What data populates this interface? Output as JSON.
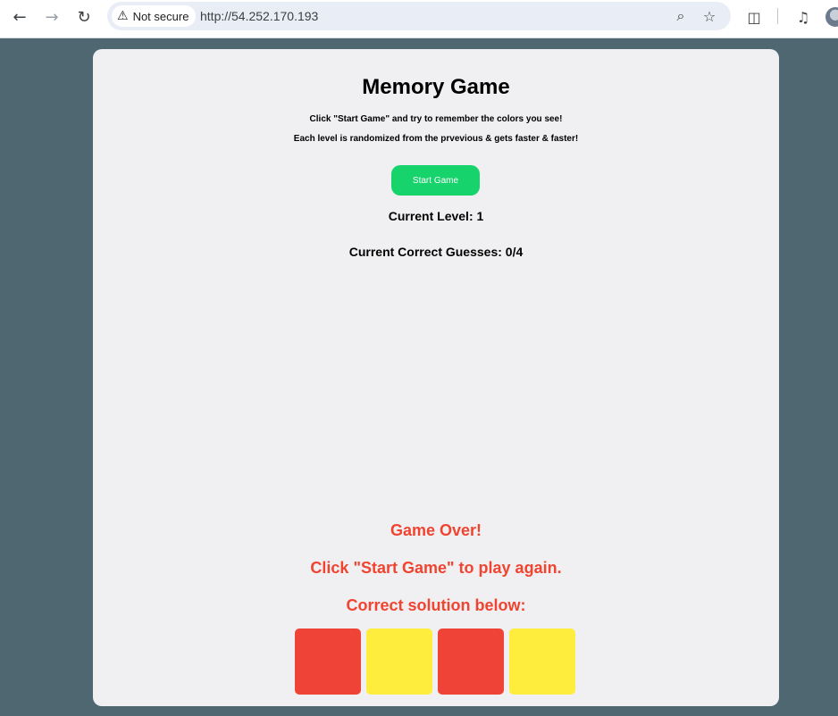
{
  "browser": {
    "security_label": "Not secure",
    "url": "http://54.252.170.193"
  },
  "game": {
    "title": "Memory Game",
    "instructions_line1": "Click \"Start Game\" and try to remember the colors you see!",
    "instructions_line2": "Each level is randomized from the prvevious & gets faster & faster!",
    "start_button_label": "Start Game",
    "level_text": "Current Level: 1",
    "guesses_text": "Current Correct Guesses: 0/4",
    "game_over_text": "Game Over!",
    "play_again_text": "Click \"Start Game\" to play again.",
    "solution_text": "Correct solution below:",
    "solution_colors": [
      "#f04338",
      "#feed3d",
      "#f04338",
      "#feed3d"
    ]
  },
  "colors": {
    "page_background": "#4f6770",
    "card_background": "#f0f0f2",
    "start_button": "#16d46b",
    "message_red": "#f04431"
  }
}
